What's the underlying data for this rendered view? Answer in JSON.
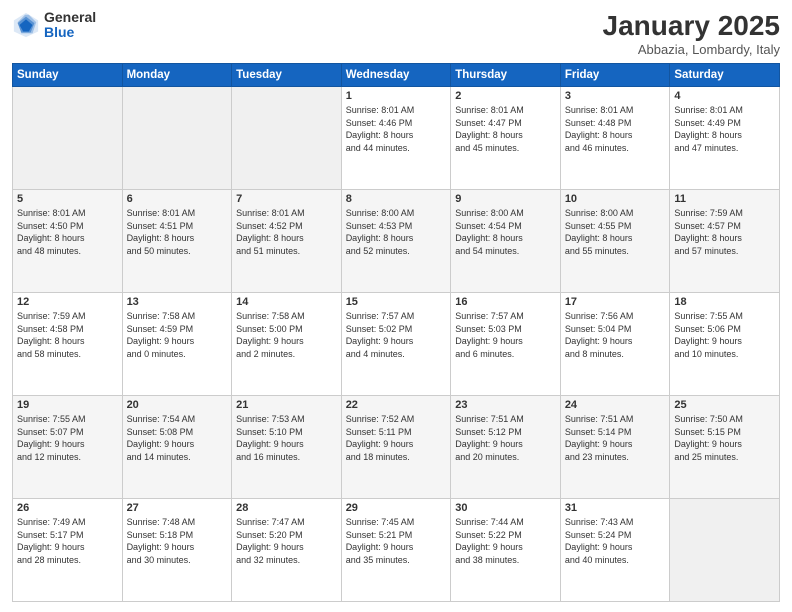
{
  "header": {
    "logo_general": "General",
    "logo_blue": "Blue",
    "month_title": "January 2025",
    "location": "Abbazia, Lombardy, Italy"
  },
  "days_of_week": [
    "Sunday",
    "Monday",
    "Tuesday",
    "Wednesday",
    "Thursday",
    "Friday",
    "Saturday"
  ],
  "weeks": [
    [
      {
        "num": "",
        "info": ""
      },
      {
        "num": "",
        "info": ""
      },
      {
        "num": "",
        "info": ""
      },
      {
        "num": "1",
        "info": "Sunrise: 8:01 AM\nSunset: 4:46 PM\nDaylight: 8 hours\nand 44 minutes."
      },
      {
        "num": "2",
        "info": "Sunrise: 8:01 AM\nSunset: 4:47 PM\nDaylight: 8 hours\nand 45 minutes."
      },
      {
        "num": "3",
        "info": "Sunrise: 8:01 AM\nSunset: 4:48 PM\nDaylight: 8 hours\nand 46 minutes."
      },
      {
        "num": "4",
        "info": "Sunrise: 8:01 AM\nSunset: 4:49 PM\nDaylight: 8 hours\nand 47 minutes."
      }
    ],
    [
      {
        "num": "5",
        "info": "Sunrise: 8:01 AM\nSunset: 4:50 PM\nDaylight: 8 hours\nand 48 minutes."
      },
      {
        "num": "6",
        "info": "Sunrise: 8:01 AM\nSunset: 4:51 PM\nDaylight: 8 hours\nand 50 minutes."
      },
      {
        "num": "7",
        "info": "Sunrise: 8:01 AM\nSunset: 4:52 PM\nDaylight: 8 hours\nand 51 minutes."
      },
      {
        "num": "8",
        "info": "Sunrise: 8:00 AM\nSunset: 4:53 PM\nDaylight: 8 hours\nand 52 minutes."
      },
      {
        "num": "9",
        "info": "Sunrise: 8:00 AM\nSunset: 4:54 PM\nDaylight: 8 hours\nand 54 minutes."
      },
      {
        "num": "10",
        "info": "Sunrise: 8:00 AM\nSunset: 4:55 PM\nDaylight: 8 hours\nand 55 minutes."
      },
      {
        "num": "11",
        "info": "Sunrise: 7:59 AM\nSunset: 4:57 PM\nDaylight: 8 hours\nand 57 minutes."
      }
    ],
    [
      {
        "num": "12",
        "info": "Sunrise: 7:59 AM\nSunset: 4:58 PM\nDaylight: 8 hours\nand 58 minutes."
      },
      {
        "num": "13",
        "info": "Sunrise: 7:58 AM\nSunset: 4:59 PM\nDaylight: 9 hours\nand 0 minutes."
      },
      {
        "num": "14",
        "info": "Sunrise: 7:58 AM\nSunset: 5:00 PM\nDaylight: 9 hours\nand 2 minutes."
      },
      {
        "num": "15",
        "info": "Sunrise: 7:57 AM\nSunset: 5:02 PM\nDaylight: 9 hours\nand 4 minutes."
      },
      {
        "num": "16",
        "info": "Sunrise: 7:57 AM\nSunset: 5:03 PM\nDaylight: 9 hours\nand 6 minutes."
      },
      {
        "num": "17",
        "info": "Sunrise: 7:56 AM\nSunset: 5:04 PM\nDaylight: 9 hours\nand 8 minutes."
      },
      {
        "num": "18",
        "info": "Sunrise: 7:55 AM\nSunset: 5:06 PM\nDaylight: 9 hours\nand 10 minutes."
      }
    ],
    [
      {
        "num": "19",
        "info": "Sunrise: 7:55 AM\nSunset: 5:07 PM\nDaylight: 9 hours\nand 12 minutes."
      },
      {
        "num": "20",
        "info": "Sunrise: 7:54 AM\nSunset: 5:08 PM\nDaylight: 9 hours\nand 14 minutes."
      },
      {
        "num": "21",
        "info": "Sunrise: 7:53 AM\nSunset: 5:10 PM\nDaylight: 9 hours\nand 16 minutes."
      },
      {
        "num": "22",
        "info": "Sunrise: 7:52 AM\nSunset: 5:11 PM\nDaylight: 9 hours\nand 18 minutes."
      },
      {
        "num": "23",
        "info": "Sunrise: 7:51 AM\nSunset: 5:12 PM\nDaylight: 9 hours\nand 20 minutes."
      },
      {
        "num": "24",
        "info": "Sunrise: 7:51 AM\nSunset: 5:14 PM\nDaylight: 9 hours\nand 23 minutes."
      },
      {
        "num": "25",
        "info": "Sunrise: 7:50 AM\nSunset: 5:15 PM\nDaylight: 9 hours\nand 25 minutes."
      }
    ],
    [
      {
        "num": "26",
        "info": "Sunrise: 7:49 AM\nSunset: 5:17 PM\nDaylight: 9 hours\nand 28 minutes."
      },
      {
        "num": "27",
        "info": "Sunrise: 7:48 AM\nSunset: 5:18 PM\nDaylight: 9 hours\nand 30 minutes."
      },
      {
        "num": "28",
        "info": "Sunrise: 7:47 AM\nSunset: 5:20 PM\nDaylight: 9 hours\nand 32 minutes."
      },
      {
        "num": "29",
        "info": "Sunrise: 7:45 AM\nSunset: 5:21 PM\nDaylight: 9 hours\nand 35 minutes."
      },
      {
        "num": "30",
        "info": "Sunrise: 7:44 AM\nSunset: 5:22 PM\nDaylight: 9 hours\nand 38 minutes."
      },
      {
        "num": "31",
        "info": "Sunrise: 7:43 AM\nSunset: 5:24 PM\nDaylight: 9 hours\nand 40 minutes."
      },
      {
        "num": "",
        "info": ""
      }
    ]
  ]
}
